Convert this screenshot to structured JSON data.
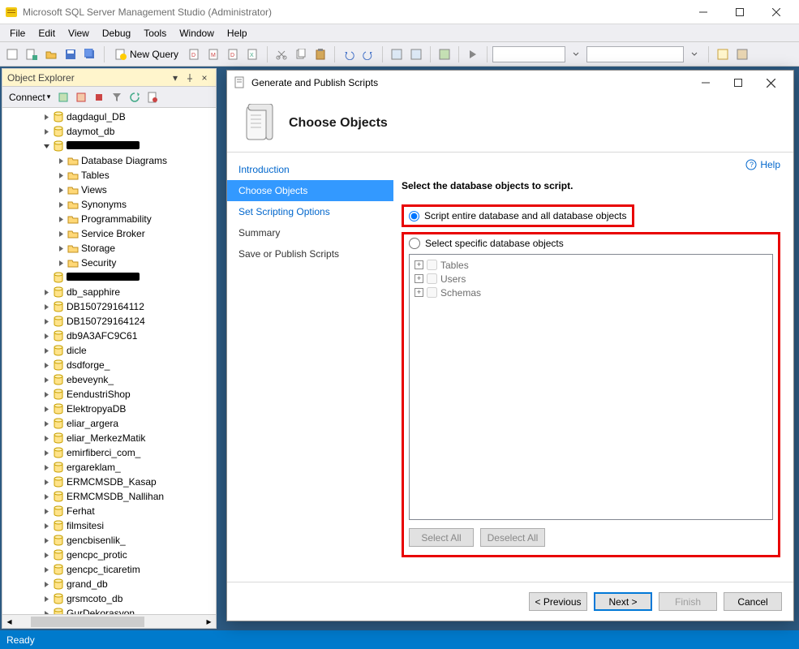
{
  "window": {
    "title": "Microsoft SQL Server Management Studio (Administrator)"
  },
  "menubar": [
    "File",
    "Edit",
    "View",
    "Debug",
    "Tools",
    "Window",
    "Help"
  ],
  "toolbar": {
    "new_query_label": "New Query"
  },
  "object_explorer": {
    "title": "Object Explorer",
    "connect_label": "Connect",
    "tree": [
      {
        "indent": 1,
        "icon": "db",
        "label": "dagdagul_DB",
        "exp": "+"
      },
      {
        "indent": 1,
        "icon": "db",
        "label": "daymot_db",
        "exp": "+"
      },
      {
        "indent": 1,
        "icon": "db",
        "label": "",
        "redacted": true,
        "exp": "-"
      },
      {
        "indent": 2,
        "icon": "folder",
        "label": "Database Diagrams",
        "exp": "+"
      },
      {
        "indent": 2,
        "icon": "folder",
        "label": "Tables",
        "exp": "+"
      },
      {
        "indent": 2,
        "icon": "folder",
        "label": "Views",
        "exp": "+"
      },
      {
        "indent": 2,
        "icon": "folder",
        "label": "Synonyms",
        "exp": "+"
      },
      {
        "indent": 2,
        "icon": "folder",
        "label": "Programmability",
        "exp": "+"
      },
      {
        "indent": 2,
        "icon": "folder",
        "label": "Service Broker",
        "exp": "+"
      },
      {
        "indent": 2,
        "icon": "folder",
        "label": "Storage",
        "exp": "+"
      },
      {
        "indent": 2,
        "icon": "folder",
        "label": "Security",
        "exp": "+"
      },
      {
        "indent": 1,
        "icon": "db",
        "label": "",
        "redacted": true,
        "exp": ""
      },
      {
        "indent": 1,
        "icon": "db",
        "label": "db_sapphire",
        "exp": "+"
      },
      {
        "indent": 1,
        "icon": "db",
        "label": "DB150729164112",
        "exp": "+"
      },
      {
        "indent": 1,
        "icon": "db",
        "label": "DB150729164124",
        "exp": "+"
      },
      {
        "indent": 1,
        "icon": "db",
        "label": "db9A3AFC9C61",
        "exp": "+"
      },
      {
        "indent": 1,
        "icon": "db",
        "label": "dicle",
        "exp": "+"
      },
      {
        "indent": 1,
        "icon": "db",
        "label": "dsdforge_",
        "exp": "+"
      },
      {
        "indent": 1,
        "icon": "db",
        "label": "ebeveynk_",
        "exp": "+"
      },
      {
        "indent": 1,
        "icon": "db",
        "label": "EendustriShop",
        "exp": "+"
      },
      {
        "indent": 1,
        "icon": "db",
        "label": "ElektropyaDB",
        "exp": "+"
      },
      {
        "indent": 1,
        "icon": "db",
        "label": "eliar_argera",
        "exp": "+"
      },
      {
        "indent": 1,
        "icon": "db",
        "label": "eliar_MerkezMatik",
        "exp": "+"
      },
      {
        "indent": 1,
        "icon": "db",
        "label": "emirfiberci_com_",
        "exp": "+"
      },
      {
        "indent": 1,
        "icon": "db",
        "label": "ergareklam_",
        "exp": "+"
      },
      {
        "indent": 1,
        "icon": "db",
        "label": "ERMCMSDB_Kasap",
        "exp": "+"
      },
      {
        "indent": 1,
        "icon": "db",
        "label": "ERMCMSDB_Nallihan",
        "exp": "+"
      },
      {
        "indent": 1,
        "icon": "db",
        "label": "Ferhat",
        "exp": "+"
      },
      {
        "indent": 1,
        "icon": "db",
        "label": "filmsitesi",
        "exp": "+"
      },
      {
        "indent": 1,
        "icon": "db",
        "label": "gencbisenlik_",
        "exp": "+"
      },
      {
        "indent": 1,
        "icon": "db",
        "label": "gencpc_protic",
        "exp": "+"
      },
      {
        "indent": 1,
        "icon": "db",
        "label": "gencpc_ticaretim",
        "exp": "+"
      },
      {
        "indent": 1,
        "icon": "db",
        "label": "grand_db",
        "exp": "+"
      },
      {
        "indent": 1,
        "icon": "db",
        "label": "grsmcoto_db",
        "exp": "+"
      },
      {
        "indent": 1,
        "icon": "db",
        "label": "GurDekorasyon",
        "exp": "+"
      }
    ]
  },
  "dialog": {
    "title": "Generate and Publish Scripts",
    "heading": "Choose Objects",
    "help_label": "Help",
    "nav": [
      {
        "label": "Introduction",
        "kind": "link"
      },
      {
        "label": "Choose Objects",
        "kind": "active"
      },
      {
        "label": "Set Scripting Options",
        "kind": "link"
      },
      {
        "label": "Summary",
        "kind": "normal"
      },
      {
        "label": "Save or Publish Scripts",
        "kind": "normal"
      }
    ],
    "content_heading": "Select the database objects to script.",
    "radio1_label": "Script entire database and all database objects",
    "radio2_label": "Select specific database objects",
    "objects": [
      "Tables",
      "Users",
      "Schemas"
    ],
    "select_all": "Select All",
    "deselect_all": "Deselect All",
    "footer": {
      "previous": "< Previous",
      "next": "Next >",
      "finish": "Finish",
      "cancel": "Cancel"
    }
  },
  "statusbar": {
    "text": "Ready"
  }
}
